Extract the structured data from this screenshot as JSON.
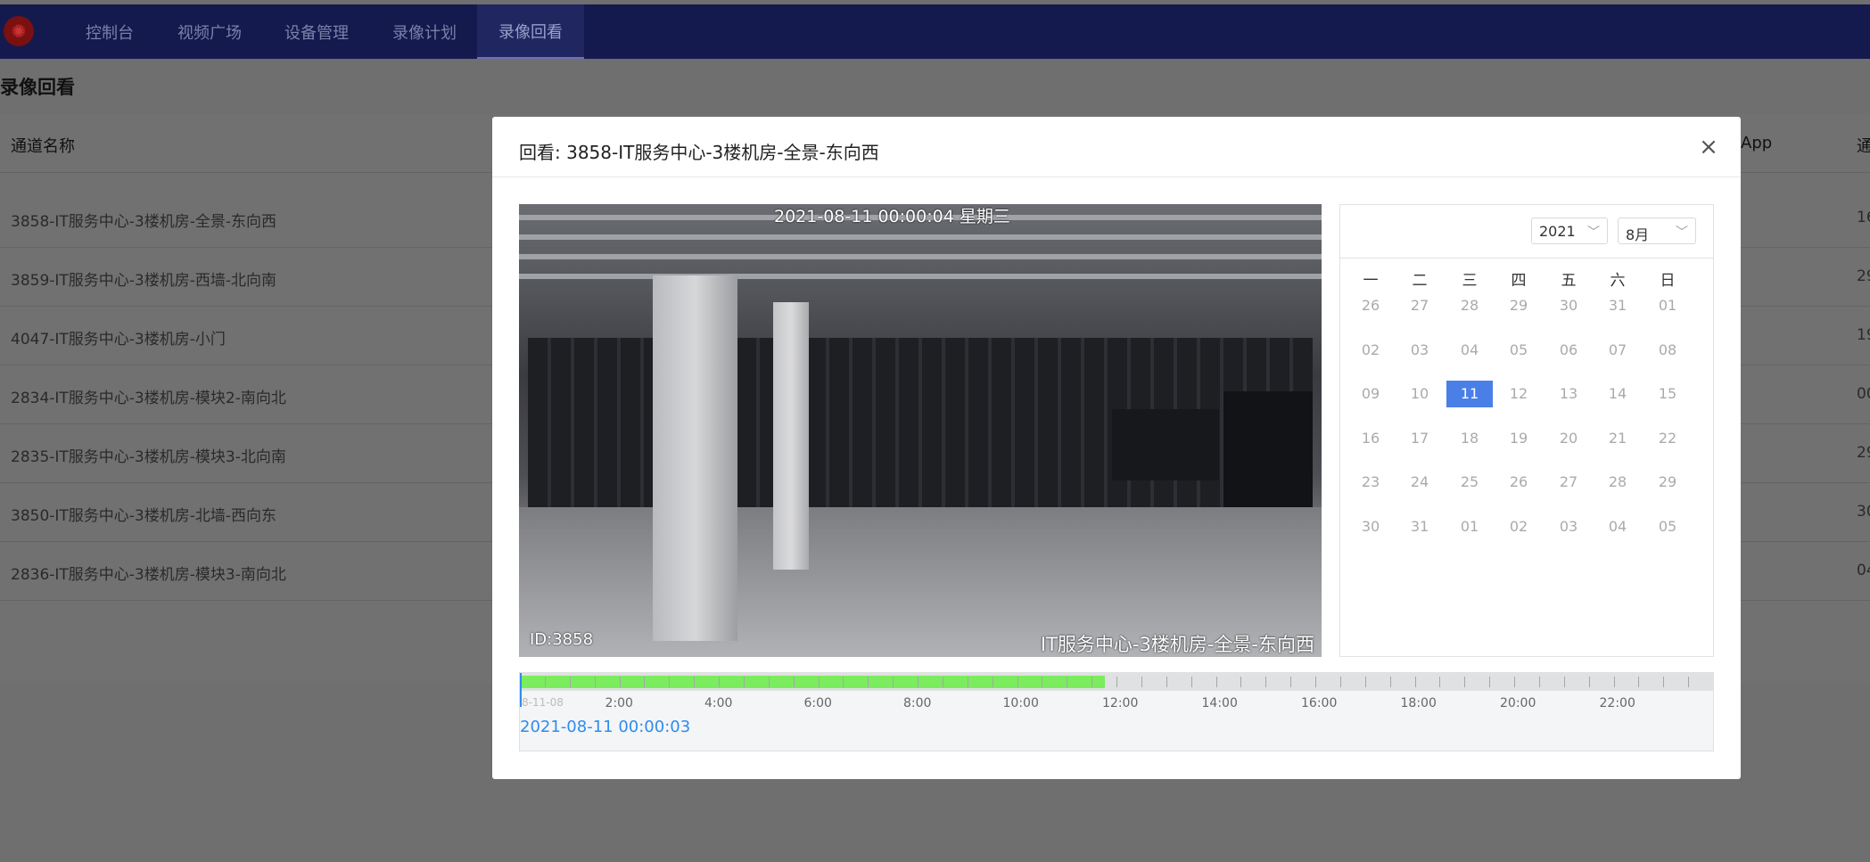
{
  "nav": {
    "items": [
      "控制台",
      "视频广场",
      "设备管理",
      "录像计划",
      "录像回看"
    ],
    "active_index": 4
  },
  "page": {
    "title": "录像回看",
    "list_header_name": "通道名称",
    "list_header_app": "App",
    "list_header_right": "通",
    "rows": [
      {
        "name": "3858-IT服务中心-3楼机房-全景-东向西",
        "right": "16"
      },
      {
        "name": "3859-IT服务中心-3楼机房-西墙-北向南",
        "right": "29"
      },
      {
        "name": "4047-IT服务中心-3楼机房-小门",
        "right": "19"
      },
      {
        "name": "2834-IT服务中心-3楼机房-模块2-南向北",
        "right": "00"
      },
      {
        "name": "2835-IT服务中心-3楼机房-模块3-北向南",
        "right": "29"
      },
      {
        "name": "3850-IT服务中心-3楼机房-北墙-西向东",
        "right": "30"
      },
      {
        "name": "2836-IT服务中心-3楼机房-模块3-南向北",
        "right": "04"
      }
    ]
  },
  "modal": {
    "title": "回看: 3858-IT服务中心-3楼机房-全景-东向西",
    "close_glyph": "×",
    "video": {
      "timestamp_osd": "2021-08-11 00:00:04 星期三",
      "id_osd": "ID:3858",
      "name_osd": "IT服务中心-3楼机房-全景-东向西"
    },
    "calendar": {
      "year": "2021",
      "month": "8月",
      "weekdays": [
        "一",
        "二",
        "三",
        "四",
        "五",
        "六",
        "日"
      ],
      "weeks": [
        [
          "26",
          "27",
          "28",
          "29",
          "30",
          "31",
          "01"
        ],
        [
          "02",
          "03",
          "04",
          "05",
          "06",
          "07",
          "08"
        ],
        [
          "09",
          "10",
          "11",
          "12",
          "13",
          "14",
          "15"
        ],
        [
          "16",
          "17",
          "18",
          "19",
          "20",
          "21",
          "22"
        ],
        [
          "23",
          "24",
          "25",
          "26",
          "27",
          "28",
          "29"
        ],
        [
          "30",
          "31",
          "01",
          "02",
          "03",
          "04",
          "05"
        ]
      ],
      "selected": "11"
    },
    "timeline": {
      "start_label": "8-11-08",
      "hour_labels": [
        "2:00",
        "4:00",
        "6:00",
        "8:00",
        "10:00",
        "12:00",
        "14:00",
        "16:00",
        "18:00",
        "20:00",
        "22:00"
      ],
      "recorded_fraction": 0.49,
      "current_time": "2021-08-11 00:00:03"
    }
  },
  "colors": {
    "topbar": "#141a4e",
    "accent": "#2d8cf0",
    "selected_day": "#4a7fe8",
    "recorded": "#7bec5e"
  }
}
